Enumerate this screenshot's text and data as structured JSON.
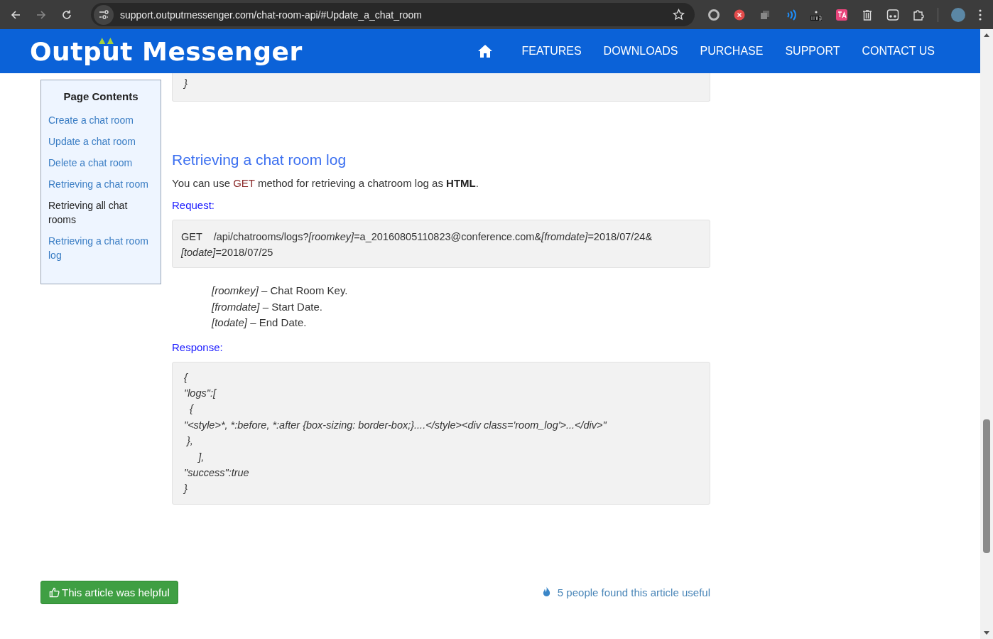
{
  "browser": {
    "url": "support.outputmessenger.com/chat-room-api/#Update_a_chat_room"
  },
  "site_header": {
    "logo": "Output Messenger",
    "nav": [
      {
        "label": "FEATURES"
      },
      {
        "label": "DOWNLOADS"
      },
      {
        "label": "PURCHASE"
      },
      {
        "label": "SUPPORT"
      },
      {
        "label": "CONTACT US"
      }
    ]
  },
  "page_contents": {
    "title": "Page Contents",
    "items": [
      {
        "label": "Create a chat room",
        "selected": false
      },
      {
        "label": "Update a chat room",
        "selected": false
      },
      {
        "label": "Delete a chat room",
        "selected": false
      },
      {
        "label": "Retrieving a chat room",
        "selected": false
      },
      {
        "label": "Retrieving all chat rooms",
        "selected": true
      },
      {
        "label": "Retrieving a chat room log",
        "selected": false
      }
    ]
  },
  "previous_code_lines": [
    "}"
  ],
  "section": {
    "heading": "Retrieving a chat room log",
    "intro": [
      {
        "text": "You can use ",
        "kind": "plain"
      },
      {
        "text": "GET",
        "kind": "method"
      },
      {
        "text": " method for retrieving a chatroom log as ",
        "kind": "plain"
      },
      {
        "text": "HTML",
        "kind": "bold"
      },
      {
        "text": ".",
        "kind": "plain"
      }
    ],
    "request_label": "Request:",
    "request": "GET    /api/chatrooms/logs?*[roomkey]*=a_20160805110823@conference.com&*[fromdate]*=2018/07/24& *[todate]*=2018/07/25",
    "params": [
      "*[roomkey]* – Chat Room Key.",
      "*[fromdate]* – Start Date.",
      "*[todate]* – End Date."
    ],
    "response_label": "Response:",
    "response_lines": [
      "{",
      "\"logs\":[",
      "  {",
      "\"<style>*, *:before, *:after {box-sizing: border-box;}....</style><div class='room_log'>...</div>\"",
      " },",
      "     ],",
      "\"success\":true",
      "}"
    ]
  },
  "footer": {
    "helpful_button": "This article was helpful",
    "useful_count": "5 people found this article useful"
  }
}
